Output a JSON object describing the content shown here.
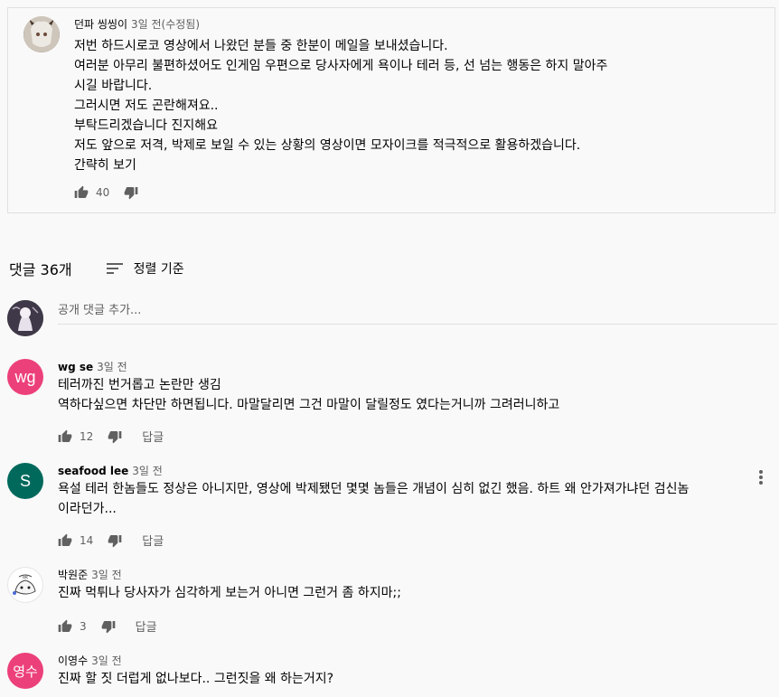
{
  "pinned": {
    "author": "던파 씽씽이",
    "time": "3일 전(수정됨)",
    "lines": [
      "저번 하드시로코 영상에서 나왔던 분들 중 한분이 메일을 보내셨습니다.",
      "여러분 아무리 불편하셨어도 인게임 우편으로 당사자에게 욕이나 테러 등, 선 넘는 행동은 하지 말아주",
      "시길 바랍니다.",
      "그러시면 저도 곤란해져요..",
      "부탁드리겠습니다 진지해요",
      "저도 앞으로 저격, 박제로 보일 수 있는 상황의 영상이면 모자이크를 적극적으로 활용하겠습니다."
    ],
    "read_less": "간략히 보기",
    "likes": "40"
  },
  "header": {
    "comment_count": "댓글 36개",
    "sort_label": "정렬 기준"
  },
  "add_comment": {
    "placeholder": "공개 댓글 추가..."
  },
  "comments": [
    {
      "avatar_text": "wg",
      "avatar_color": "#ec407a",
      "author": "wg se",
      "time": "3일 전",
      "lines": [
        "테러까진 번거롭고 논란만 생김",
        "역하다싶으면 차단만 하면됩니다. 마말달리면 그건 마말이 달릴정도 였다는거니까 그려러니하고"
      ],
      "likes": "12",
      "reply": "답글"
    },
    {
      "avatar_text": "S",
      "avatar_color": "#00695c",
      "author": "seafood lee",
      "time": "3일 전",
      "lines": [
        "욕설 테러 한놈들도 정상은 아니지만, 영상에 박제됐던 몇몇 놈들은 개념이 심히 없긴 했음. 하트 왜 안가져가냐던 검신놈",
        "이라던가..."
      ],
      "likes": "14",
      "reply": "답글"
    },
    {
      "avatar_text": "",
      "avatar_color": "#ffffff",
      "author": "박원준",
      "time": "3일 전",
      "lines": [
        "진짜 먹튀나 당사자가 심각하게 보는거 아니면 그런거 좀 하지마;;"
      ],
      "likes": "3",
      "reply": "답글"
    },
    {
      "avatar_text": "영수",
      "avatar_color": "#ec407a",
      "author": "이영수",
      "time": "3일 전",
      "lines": [
        "진짜 할 짓 더럽게 없나보다.. 그런짓을 왜 하는거지?"
      ]
    }
  ],
  "icons": {
    "like": "thumb-up-icon",
    "dislike": "thumb-down-icon",
    "sort": "sort-icon",
    "more": "more-vert-icon"
  }
}
